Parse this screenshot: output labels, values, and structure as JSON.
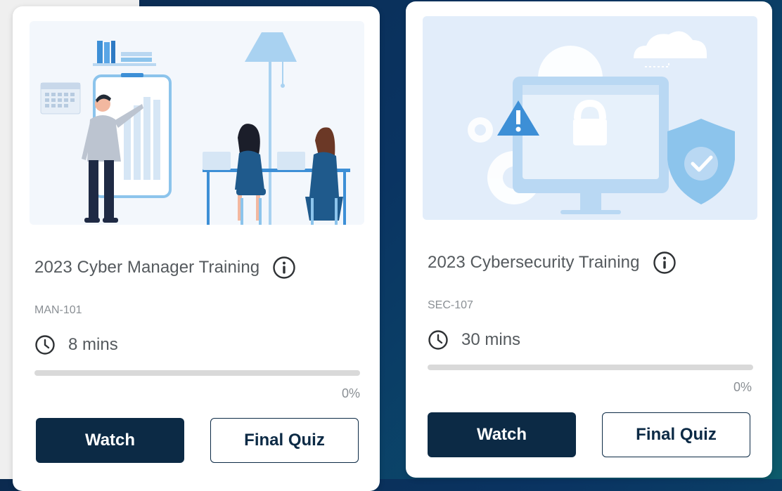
{
  "courses": [
    {
      "title": "2023 Cyber Manager Training",
      "code": "MAN-101",
      "duration": "8 mins",
      "progress_percent": 0,
      "progress_label": "0%",
      "watch_label": "Watch",
      "quiz_label": "Final Quiz",
      "illustration": "presenter-with-chart-and-team-illustration"
    },
    {
      "title": "2023 Cybersecurity Training",
      "code": "SEC-107",
      "duration": "30 mins",
      "progress_percent": 0,
      "progress_label": "0%",
      "watch_label": "Watch",
      "quiz_label": "Final Quiz",
      "illustration": "computer-lock-shield-warning-illustration"
    }
  ],
  "colors": {
    "primary": "#0c2a45",
    "text": "#555a5e",
    "muted": "#8a8f94",
    "track": "#d9d9d9",
    "illustration_blue": "#8cc4ec"
  },
  "icons": [
    "info-icon",
    "clock-icon"
  ]
}
